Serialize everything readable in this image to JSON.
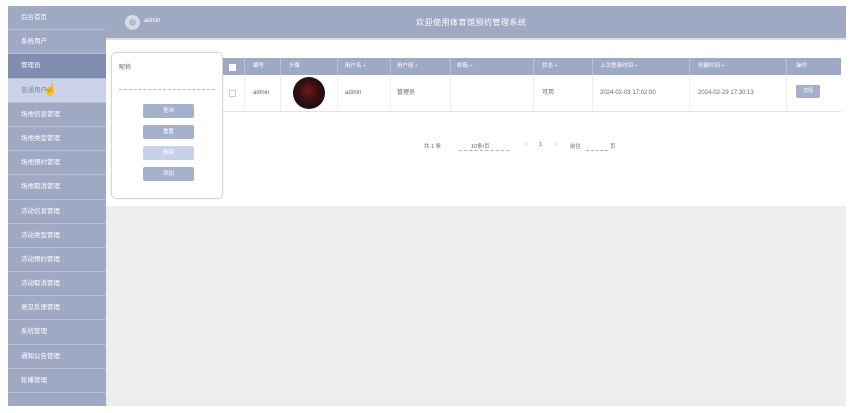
{
  "header": {
    "brand": "admin",
    "title": "欢迎使用体育馆预约管理系统"
  },
  "sidebar": {
    "items": [
      {
        "label": "后台首页",
        "state": "normal"
      },
      {
        "label": "系统用户",
        "state": "normal"
      },
      {
        "label": "管理员",
        "state": "active"
      },
      {
        "label": "普通用户",
        "state": "sub"
      },
      {
        "label": "场地信息管理",
        "state": "normal"
      },
      {
        "label": "场地类型管理",
        "state": "normal"
      },
      {
        "label": "场地预约管理",
        "state": "normal"
      },
      {
        "label": "场地取消管理",
        "state": "normal"
      },
      {
        "label": "活动信息管理",
        "state": "normal"
      },
      {
        "label": "活动类型管理",
        "state": "normal"
      },
      {
        "label": "活动预约管理",
        "state": "normal"
      },
      {
        "label": "活动取消管理",
        "state": "normal"
      },
      {
        "label": "意见反馈管理",
        "state": "normal"
      },
      {
        "label": "系统管理",
        "state": "normal"
      },
      {
        "label": "通知公告管理",
        "state": "normal"
      },
      {
        "label": "轮播管理",
        "state": "normal"
      }
    ]
  },
  "search": {
    "label": "昵称",
    "value": "",
    "placeholder": "",
    "buttons": {
      "query": "查询",
      "reset": "重置",
      "delete": "删除",
      "add": "添加"
    }
  },
  "table": {
    "columns": [
      "编号",
      "头像",
      "用户名",
      "用户组",
      "邮箱",
      "状态",
      "上次登录时间",
      "创建时间",
      "操作"
    ],
    "rows": [
      {
        "id": "admin",
        "username": "admin",
        "group": "管理员",
        "email": "",
        "status": "可用",
        "last_login": "2024-02-03 17:02:00",
        "created": "2024-02-29 17:30:13",
        "action": "详情"
      }
    ]
  },
  "pagination": {
    "total": "共 1 条",
    "page_size": "10条/页",
    "prev": "<",
    "current_page": "1",
    "next": ">",
    "goto_prefix": "前往",
    "goto_value": "",
    "goto_suffix": "页"
  },
  "colors": {
    "theme": "#9fa9c4",
    "sidebar_active": "#7f8db0",
    "sidebar_sub": "#c9d2e6",
    "button": "#a5b0ca",
    "page_link": "#6b86c9"
  },
  "icons": [
    "logo-icon",
    "pointer-cursor-icon",
    "checkbox-icon",
    "sort-caret-icon"
  ]
}
